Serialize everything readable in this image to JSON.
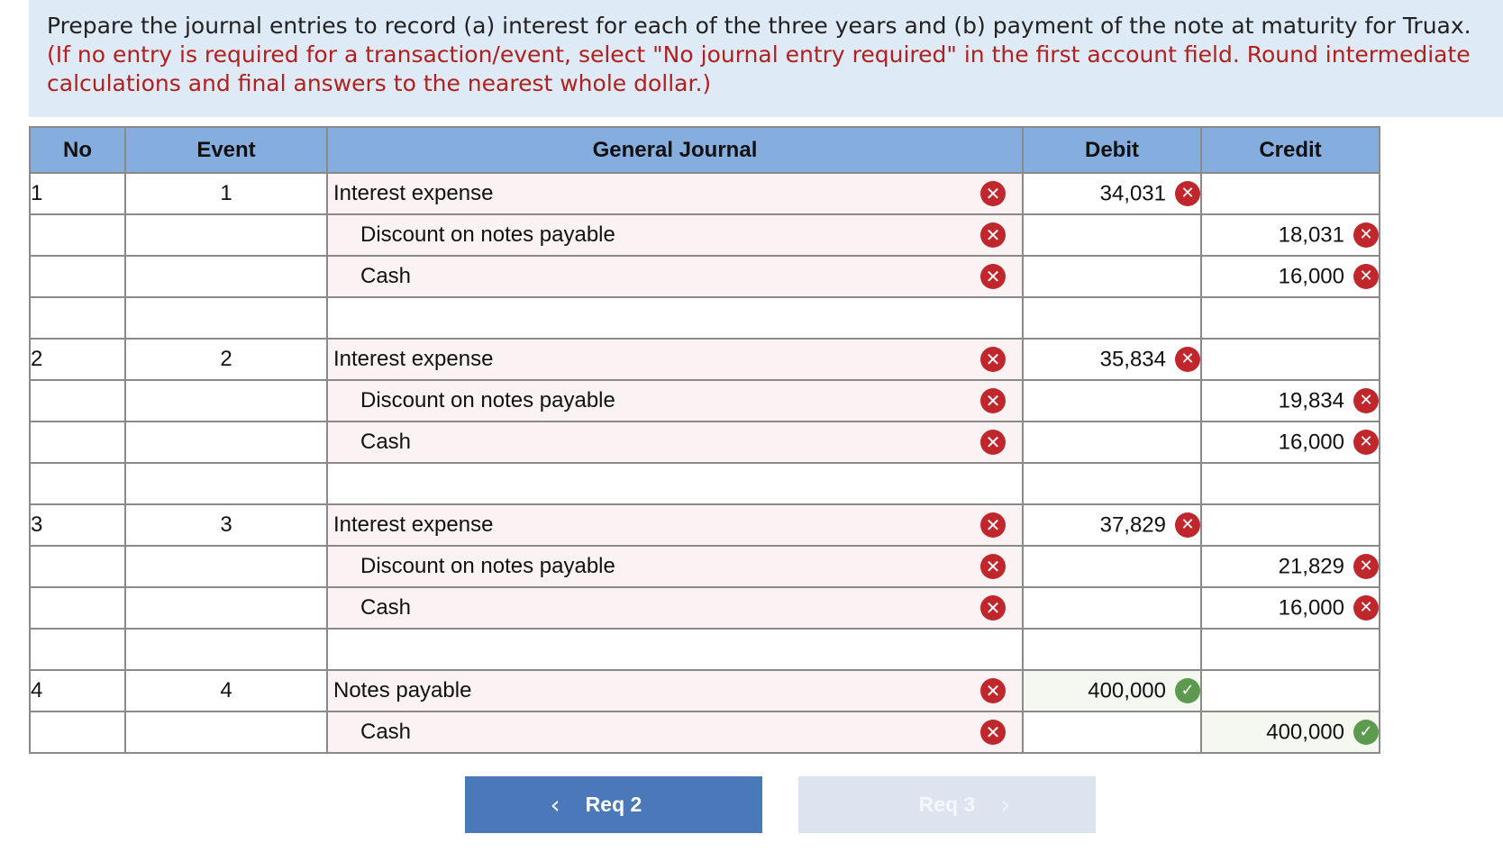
{
  "instructions": {
    "main": "Prepare the journal entries to record (a) interest for each of the three years and (b) payment of the note at maturity for Truax.",
    "note": "(If no entry is required for a transaction/event, select \"No journal entry required\" in the first account field. Round intermediate calculations and final answers to the nearest whole dollar.)"
  },
  "table": {
    "headers": {
      "no": "No",
      "event": "Event",
      "journal": "General Journal",
      "debit": "Debit",
      "credit": "Credit"
    },
    "rows": [
      {
        "no": "1",
        "event": "1",
        "account": "Interest expense",
        "debit": "34,031",
        "credit": ""
      },
      {
        "no": "",
        "event": "",
        "account": "Discount on notes payable",
        "debit": "",
        "credit": "18,031"
      },
      {
        "no": "",
        "event": "",
        "account": "Cash",
        "debit": "",
        "credit": "16,000"
      },
      {
        "no": "",
        "event": "",
        "account": "",
        "debit": "",
        "credit": ""
      },
      {
        "no": "2",
        "event": "2",
        "account": "Interest expense",
        "debit": "35,834",
        "credit": ""
      },
      {
        "no": "",
        "event": "",
        "account": "Discount on notes payable",
        "debit": "",
        "credit": "19,834"
      },
      {
        "no": "",
        "event": "",
        "account": "Cash",
        "debit": "",
        "credit": "16,000"
      },
      {
        "no": "",
        "event": "",
        "account": "",
        "debit": "",
        "credit": ""
      },
      {
        "no": "3",
        "event": "3",
        "account": "Interest expense",
        "debit": "37,829",
        "credit": ""
      },
      {
        "no": "",
        "event": "",
        "account": "Discount on notes payable",
        "debit": "",
        "credit": "21,829"
      },
      {
        "no": "",
        "event": "",
        "account": "Cash",
        "debit": "",
        "credit": "16,000"
      },
      {
        "no": "",
        "event": "",
        "account": "",
        "debit": "",
        "credit": ""
      },
      {
        "no": "4",
        "event": "4",
        "account": "Notes payable",
        "debit": "400,000",
        "credit": ""
      },
      {
        "no": "",
        "event": "",
        "account": "Cash",
        "debit": "",
        "credit": "400,000"
      }
    ]
  },
  "nav": {
    "prev_label": "Req 2",
    "next_label": "Req 3"
  },
  "icons": {
    "incorrect": "x-circle-icon",
    "correct": "check-circle-icon",
    "prev": "chevron-left-icon",
    "next": "chevron-right-icon"
  },
  "colors": {
    "header_bg": "#85aedf",
    "instructions_bg": "#deeaf6",
    "incorrect": "#c0272d",
    "correct": "#5b9a4f",
    "note_text": "#b0201e",
    "prev_button": "#4a78b9",
    "next_button_disabled": "#dce4ef"
  }
}
